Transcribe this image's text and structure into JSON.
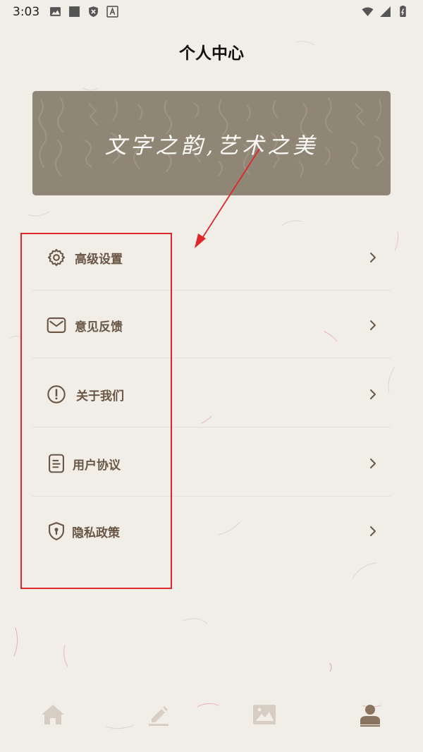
{
  "status_bar": {
    "time": "3:03",
    "left_icons": [
      "image-icon",
      "square-icon",
      "shield-x-icon",
      "a-icon"
    ],
    "right_icons": [
      "wifi-icon",
      "cellular-icon",
      "battery-icon"
    ]
  },
  "page": {
    "title": "个人中心"
  },
  "banner": {
    "text": "文字之韵,艺术之美"
  },
  "menu": {
    "items": [
      {
        "label": "高级设置",
        "icon": "gear-icon"
      },
      {
        "label": "意见反馈",
        "icon": "envelope-icon"
      },
      {
        "label": "关于我们",
        "icon": "info-circle-icon"
      },
      {
        "label": "用户协议",
        "icon": "document-icon"
      },
      {
        "label": "隐私政策",
        "icon": "shield-lock-icon"
      }
    ]
  },
  "bottom_nav": {
    "items": [
      {
        "icon": "home-icon",
        "active": false
      },
      {
        "icon": "edit-icon",
        "active": false
      },
      {
        "icon": "gallery-icon",
        "active": false
      },
      {
        "icon": "profile-icon",
        "active": true
      }
    ]
  },
  "colors": {
    "background": "#f1eee8",
    "accent_brown": "#6a5645",
    "nav_inactive": "#d6cec2",
    "nav_active": "#8a7460",
    "annotation_red": "#e0262b"
  }
}
